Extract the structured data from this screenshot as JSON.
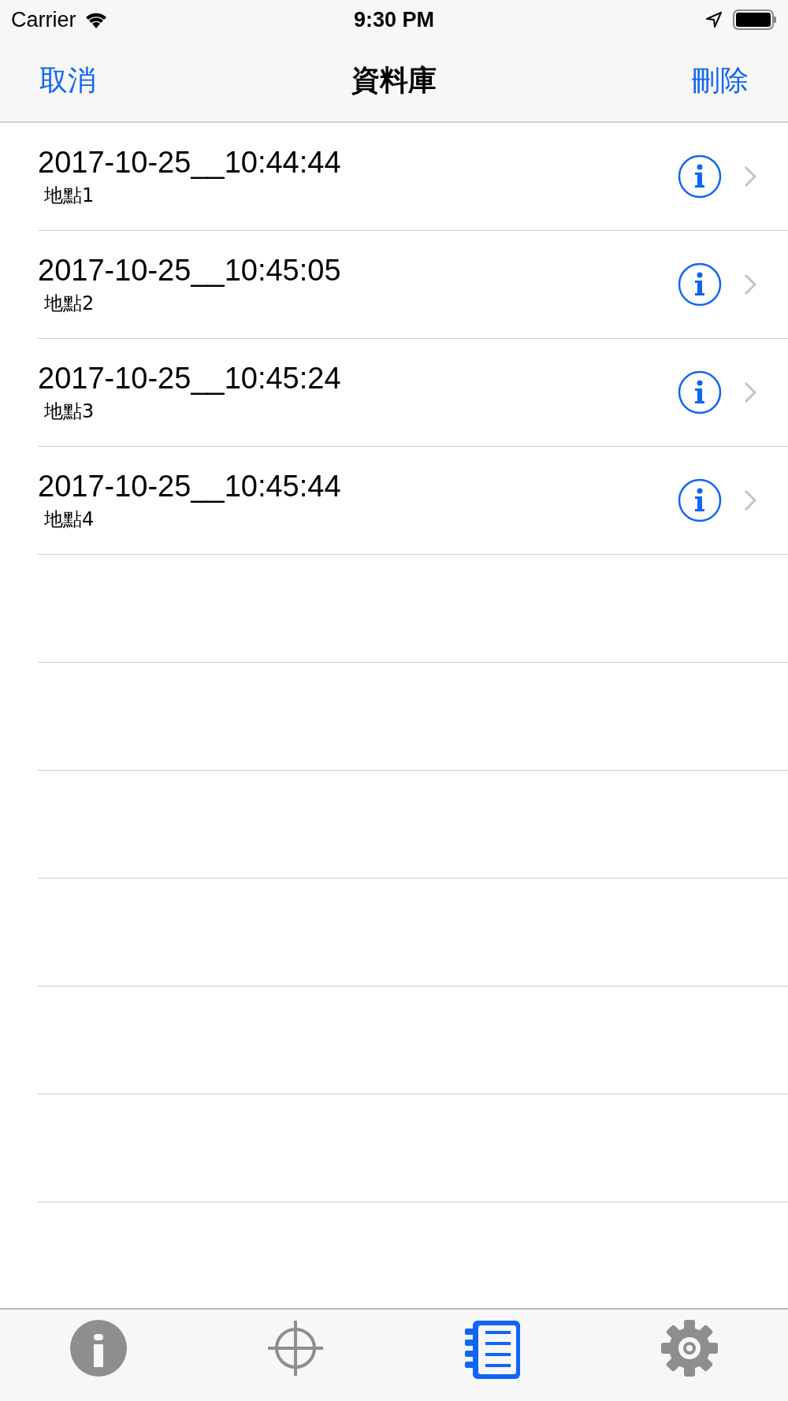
{
  "status_bar": {
    "carrier": "Carrier",
    "time": "9:30 PM"
  },
  "nav_bar": {
    "left_button": "取消",
    "title": "資料庫",
    "right_button": "刪除"
  },
  "records": [
    {
      "title": "2017-10-25__10:44:44",
      "subtitle": "地點1"
    },
    {
      "title": "2017-10-25__10:45:05",
      "subtitle": "地點2"
    },
    {
      "title": "2017-10-25__10:45:24",
      "subtitle": "地點3"
    },
    {
      "title": "2017-10-25__10:45:44",
      "subtitle": "地點4"
    }
  ],
  "tab_bar": [
    {
      "kind": "info",
      "selected": false
    },
    {
      "kind": "target",
      "selected": false
    },
    {
      "kind": "notebook",
      "selected": true
    },
    {
      "kind": "settings",
      "selected": false
    }
  ]
}
